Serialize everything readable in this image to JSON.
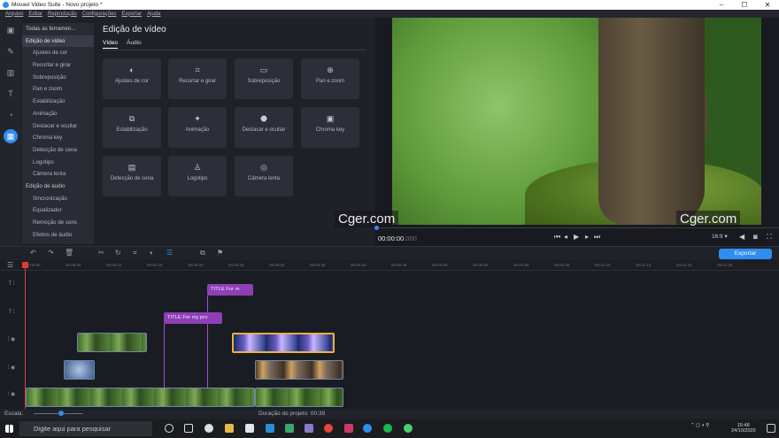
{
  "titlebar": {
    "title": "Movavi Video Suite - Novo projeto *"
  },
  "menu": [
    "Arquivo",
    "Editar",
    "Reprodução",
    "Configurações",
    "Exportar",
    "Ajuda"
  ],
  "tools": {
    "all": "Todas as ferramen...",
    "video_header": "Edição de vídeo",
    "video_items": [
      "Ajustes de cor",
      "Recortar e girar",
      "Sobreposição",
      "Pan e zoom",
      "Estabilização",
      "Animação",
      "Destacar e ocultar",
      "Chroma key",
      "Detecção de cena",
      "Logotipo",
      "Câmera lenta"
    ],
    "audio_header": "Edição de áudio",
    "audio_items": [
      "Sincronização",
      "Equalizador",
      "Remoção de sons",
      "Efeitos de áudio"
    ]
  },
  "editor": {
    "title": "Edição de vídeo",
    "tab_video": "Vídeo",
    "tab_audio": "Áudio",
    "tiles": [
      "Ajustes de cor",
      "Recortar e girar",
      "Sobreposição",
      "Pan e zoom",
      "Estabilização",
      "Animação",
      "Destacar e ocultar",
      "Chroma key",
      "Detecção de cena",
      "Logotipo",
      "Câmera lenta"
    ]
  },
  "player": {
    "time_main": "00:00:00",
    "time_ms": ".000",
    "aspect": "16:9 ▾"
  },
  "watermark": "Cger.com",
  "toolbar": {
    "export": "Exportar"
  },
  "ruler": [
    "00:00:00",
    "00:00:05",
    "00:00:10",
    "00:00:15",
    "00:00:20",
    "00:00:25",
    "00:00:30",
    "00:00:35",
    "00:00:40",
    "00:00:45",
    "00:00:50",
    "00:00:55",
    "00:01:00",
    "00:01:05",
    "00:01:10",
    "00:01:15",
    "00:01:20",
    "00:01:25"
  ],
  "titles": {
    "clip1": "TITLE For m",
    "clip2": "TITLE For my pro"
  },
  "footer": {
    "scale": "Escala:",
    "duration": "Duração do projeto: 00:39"
  },
  "taskbar": {
    "search": "Digite aqui para pesquisar",
    "time": "15:48",
    "date": "24/10/2020"
  }
}
